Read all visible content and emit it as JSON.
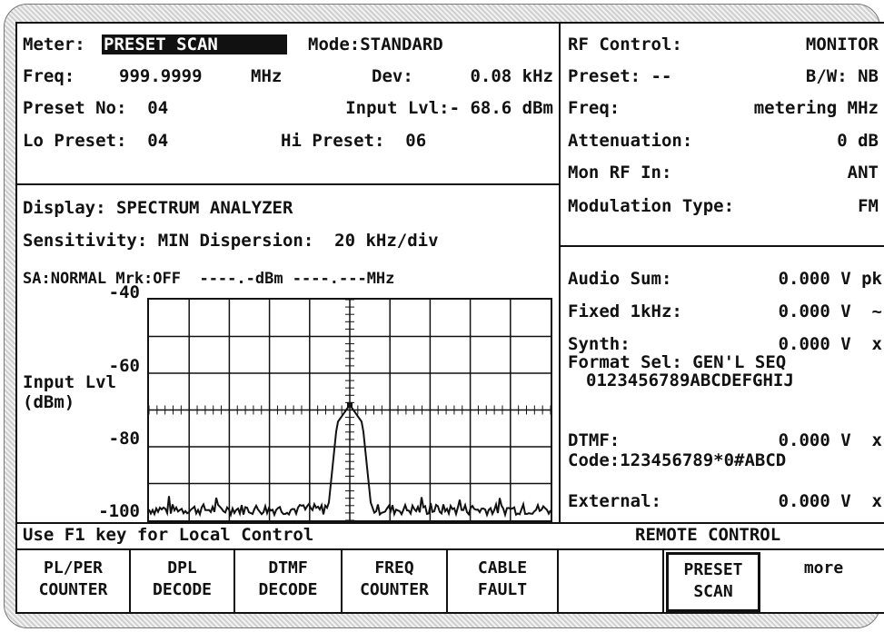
{
  "meter": {
    "label": "Meter:",
    "value": "PRESET SCAN",
    "mode": "Mode:STANDARD",
    "freq_label": "Freq:",
    "freq_value": "999.9999",
    "freq_unit": "MHz",
    "dev_label": "Dev:",
    "dev_value": "0.08 kHz",
    "preset_no": "Preset No:  04",
    "input_lvl": "Input Lvl:- 68.6 dBm",
    "lo_preset": "Lo Preset:  04",
    "hi_preset": "Hi Preset:  06"
  },
  "display": {
    "title": "Display: SPECTRUM ANALYZER",
    "sensitivity": "Sensitivity: MIN Dispersion:  20 kHz/div",
    "sa_status": "SA:NORMAL Mrk:OFF  ----.-dBm ----.---MHz",
    "y_ticks": [
      "-40",
      "-60",
      "-80",
      "-100"
    ],
    "y_label_1": "Input Lvl",
    "y_label_2": "(dBm)"
  },
  "rf": {
    "control_label": "RF Control:",
    "control_value": "MONITOR",
    "preset_label": "Preset: --",
    "bw": "B/W: NB",
    "freq_label": "Freq:",
    "freq_value": "metering MHz",
    "atten_label": "Attenuation:",
    "atten_value": "0 dB",
    "mon_label": "Mon RF In:",
    "mon_value": "ANT",
    "mod_label": "Modulation Type:",
    "mod_value": "FM"
  },
  "audio": {
    "sum_label": "Audio Sum:",
    "sum_value": "0.000 V pk",
    "fixed_label": "Fixed 1kHz:",
    "fixed_value": "0.000 V  ~",
    "synth_label": "Synth:",
    "synth_value": "0.000 V  x",
    "format_sel": "Format Sel: GEN'L SEQ",
    "format_chars": "0123456789ABCDEFGHIJ",
    "dtmf_label": "DTMF:",
    "dtmf_value": "0.000 V  x",
    "dtmf_code": "Code:123456789*0#ABCD",
    "external_label": "External:",
    "external_value": "0.000 V  x"
  },
  "status": {
    "hint": "Use F1 key for Local Control",
    "remote": "REMOTE CONTROL"
  },
  "softkeys": [
    {
      "l1": "PL/PER",
      "l2": "COUNTER"
    },
    {
      "l1": "DPL",
      "l2": "DECODE"
    },
    {
      "l1": "DTMF",
      "l2": "DECODE"
    },
    {
      "l1": "FREQ",
      "l2": "COUNTER"
    },
    {
      "l1": "CABLE",
      "l2": "FAULT"
    },
    {
      "l1": "",
      "l2": ""
    },
    {
      "l1": "PRESET",
      "l2": "SCAN"
    },
    {
      "l1": "more",
      "l2": ""
    }
  ],
  "chart_data": {
    "type": "line",
    "ylim": [
      -100,
      -40
    ],
    "x_divisions": 10,
    "y_divisions": 6,
    "marker_center": true,
    "peak_value_dbm": -68.6
  }
}
